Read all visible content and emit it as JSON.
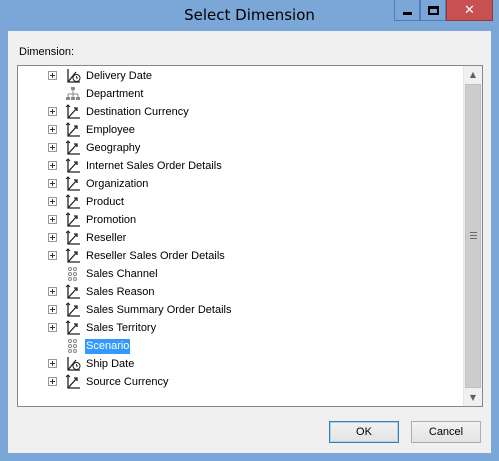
{
  "window": {
    "title": "Select Dimension",
    "close_glyph": "✕"
  },
  "dimension_label": "Dimension:",
  "tree": {
    "items": [
      {
        "label": "Delivery Date",
        "icon": "time-dimension-icon",
        "expandable": true,
        "selected": false
      },
      {
        "label": "Department",
        "icon": "hierarchy-icon",
        "expandable": false,
        "selected": false
      },
      {
        "label": "Destination Currency",
        "icon": "dimension-icon",
        "expandable": true,
        "selected": false
      },
      {
        "label": "Employee",
        "icon": "dimension-icon",
        "expandable": true,
        "selected": false
      },
      {
        "label": "Geography",
        "icon": "dimension-icon",
        "expandable": true,
        "selected": false
      },
      {
        "label": "Internet Sales Order Details",
        "icon": "dimension-icon",
        "expandable": true,
        "selected": false
      },
      {
        "label": "Organization",
        "icon": "dimension-icon",
        "expandable": true,
        "selected": false
      },
      {
        "label": "Product",
        "icon": "dimension-icon",
        "expandable": true,
        "selected": false
      },
      {
        "label": "Promotion",
        "icon": "dimension-icon",
        "expandable": true,
        "selected": false
      },
      {
        "label": "Reseller",
        "icon": "dimension-icon",
        "expandable": true,
        "selected": false
      },
      {
        "label": "Reseller Sales Order Details",
        "icon": "dimension-icon",
        "expandable": true,
        "selected": false
      },
      {
        "label": "Sales Channel",
        "icon": "attribute-icon",
        "expandable": false,
        "selected": false
      },
      {
        "label": "Sales Reason",
        "icon": "dimension-icon",
        "expandable": true,
        "selected": false
      },
      {
        "label": "Sales Summary Order Details",
        "icon": "dimension-icon",
        "expandable": true,
        "selected": false
      },
      {
        "label": "Sales Territory",
        "icon": "dimension-icon",
        "expandable": true,
        "selected": false
      },
      {
        "label": "Scenario",
        "icon": "attribute-icon",
        "expandable": false,
        "selected": true
      },
      {
        "label": "Ship Date",
        "icon": "time-dimension-icon",
        "expandable": true,
        "selected": false
      },
      {
        "label": "Source Currency",
        "icon": "dimension-icon",
        "expandable": true,
        "selected": false
      }
    ]
  },
  "buttons": {
    "ok": "OK",
    "cancel": "Cancel"
  },
  "colors": {
    "titlebar": "#7aa7d8",
    "selection": "#3399ff",
    "close": "#c75050"
  }
}
